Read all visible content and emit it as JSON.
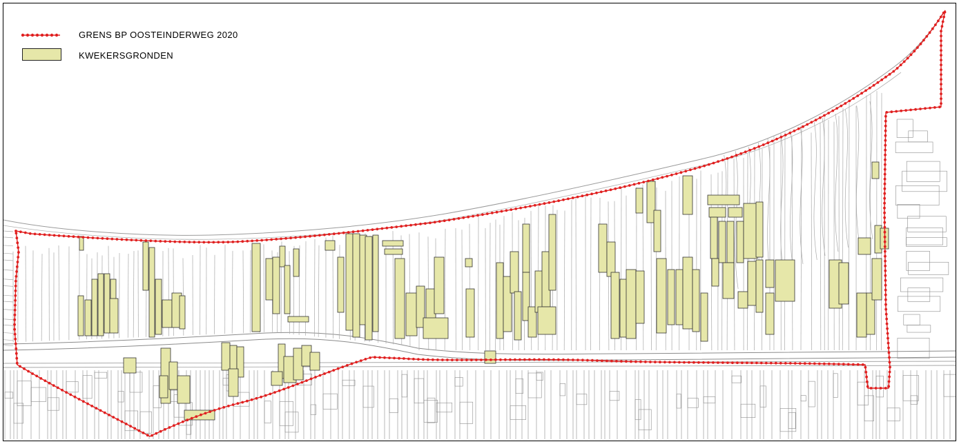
{
  "legend": {
    "items": [
      {
        "label": "GRENS BP OOSTEINDERWEG 2020",
        "symbol": "red-dotted-line",
        "color": "#e02020"
      },
      {
        "label": "KWEKERSGRONDEN",
        "symbol": "filled-rectangle",
        "color": "#e6e7a9"
      }
    ]
  },
  "colors": {
    "boundary": "#e02020",
    "kwekersgronden_fill": "#e6e7a9",
    "kwekersgronden_stroke": "#333333",
    "basemap_lines": "#9a9a9a",
    "frame": "#000000"
  }
}
